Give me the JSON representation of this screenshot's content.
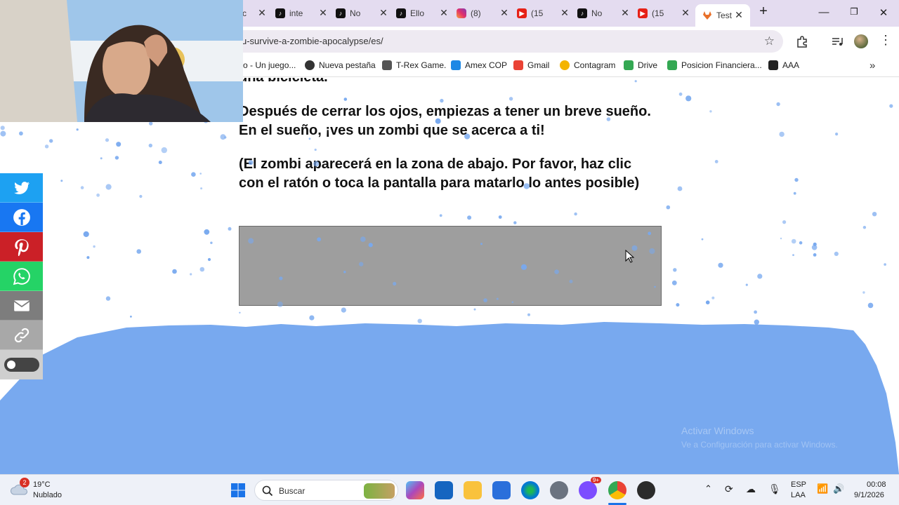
{
  "tabs": [
    {
      "title": "inte",
      "icon": "tiktok-icon"
    },
    {
      "title": "No",
      "icon": "tiktok-icon"
    },
    {
      "title": "Ello",
      "icon": "tiktok-icon"
    },
    {
      "title": "(8)",
      "icon": "instagram-icon"
    },
    {
      "title": "(15",
      "icon": "youtube-icon"
    },
    {
      "title": "No",
      "icon": "tiktok-icon"
    },
    {
      "title": "(15",
      "icon": "youtube-icon"
    }
  ],
  "active_tab": {
    "title": "Test",
    "icon": "gitlab-icon"
  },
  "address_bar": {
    "url": "u-survive-a-zombie-apocalypse/es/"
  },
  "bookmarks": [
    {
      "label": "o - Un juego...",
      "icon": "game-icon",
      "color": "#4a90d9"
    },
    {
      "label": "Nueva pestaña",
      "icon": "globe-icon",
      "color": "#333333"
    },
    {
      "label": "T-Rex Game.",
      "icon": "trex-icon",
      "color": "#555555"
    },
    {
      "label": "Amex COP",
      "icon": "amex-icon",
      "color": "#1e88e5"
    },
    {
      "label": "Gmail",
      "icon": "gmail-icon",
      "color": "#ea4335"
    },
    {
      "label": "Contagram",
      "icon": "contagram-icon",
      "color": "#f4b400"
    },
    {
      "label": "Drive",
      "icon": "drive-icon",
      "color": "#34a853"
    },
    {
      "label": "Posicion Financiera...",
      "icon": "drive-icon",
      "color": "#34a853"
    },
    {
      "label": "AAA",
      "icon": "aaa-icon",
      "color": "#222222"
    }
  ],
  "content": {
    "partial_line": "una bicicleta.",
    "paragraph1": "Después de cerrar los ojos, empiezas a tener un breve sueño. En el sueño, ¡ves un zombi que se acerca a ti!",
    "paragraph2": "(El zombi aparecerá en la zona de abajo. Por favor, haz clic con el ratón o toca la pantalla para matarlo lo antes posible)"
  },
  "watermark": {
    "line1": "Activar Windows",
    "line2": "Ve a Configuración para activar Windows."
  },
  "share_buttons": [
    {
      "name": "twitter",
      "color": "#1da1f2"
    },
    {
      "name": "facebook",
      "color": "#1877f2"
    },
    {
      "name": "pinterest",
      "color": "#cb2027"
    },
    {
      "name": "whatsapp",
      "color": "#25d366"
    },
    {
      "name": "email",
      "color": "#7d7d7d"
    },
    {
      "name": "link",
      "color": "#a8a8a8"
    }
  ],
  "colors": {
    "snow": "#78a9ef",
    "game_area": "#9e9e9e",
    "tabbar": "#e4dcf0"
  },
  "taskbar": {
    "weather_temp": "19°C",
    "weather_desc": "Nublado",
    "weather_badge": "2",
    "search_placeholder": "Buscar",
    "language": "ESP",
    "language_sub": "LAA",
    "time": "00:08",
    "date": "9/1/2026",
    "discord_badge": "9+"
  }
}
